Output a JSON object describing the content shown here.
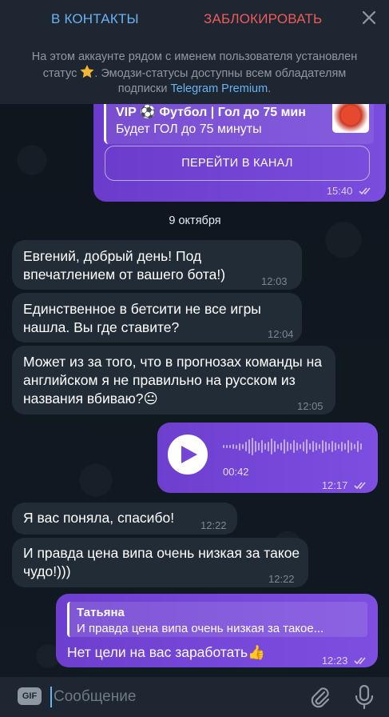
{
  "top_bar": {
    "add_contact_label": "В КОНТАКТЫ",
    "block_label": "ЗАБЛОКИРОВАТЬ",
    "close_icon": "close-icon",
    "note_part1": "На этом аккаунте рядом с именем пользователя установлен статус",
    "note_part2": ". Эмодзи-статусы доступны всем обладателям подписки",
    "note_link": "Telegram Premium",
    "note_end": "."
  },
  "vip_message": {
    "title": "VIP ⚽ Футбол | Гол до 75 мин",
    "subtitle": "Будет ГОЛ до 75 минуты",
    "button_label": "ПЕРЕЙТИ В КАНАЛ",
    "time": "15:40"
  },
  "date_separator": "9 октября",
  "messages": [
    {
      "text": "Евгений,  добрый день!  Под впечатлением от вашего бота!)",
      "time": "12:03"
    },
    {
      "text": "Единственное в бетсити не все игры нашла. Вы где ставите?",
      "time": "12:04"
    },
    {
      "text": "Может из за того, что в прогнозах команды на английском я не правильно на русском из названия вбиваю?",
      "emoji": "😐",
      "time": "12:05"
    },
    {
      "text": "Я вас поняла, спасибо!",
      "time": "12:22"
    },
    {
      "text": "И правда цена випа очень низкая за такое чудо!)))",
      "time": "12:22"
    }
  ],
  "voice_message": {
    "duration": "00:42",
    "time": "12:17"
  },
  "reply_message": {
    "quoted_author": "Татьяна",
    "quoted_text": "И правда цена випа очень низкая за такое...",
    "text": "Нет цели на вас заработать",
    "emoji": "👍",
    "time": "12:23"
  },
  "input_bar": {
    "gif_label": "GIF",
    "placeholder": "Сообщение"
  },
  "colors": {
    "accent": "#6ab3f3",
    "danger": "#ef5b5b",
    "outgoing": "#7446d8",
    "incoming": "#222c37"
  }
}
